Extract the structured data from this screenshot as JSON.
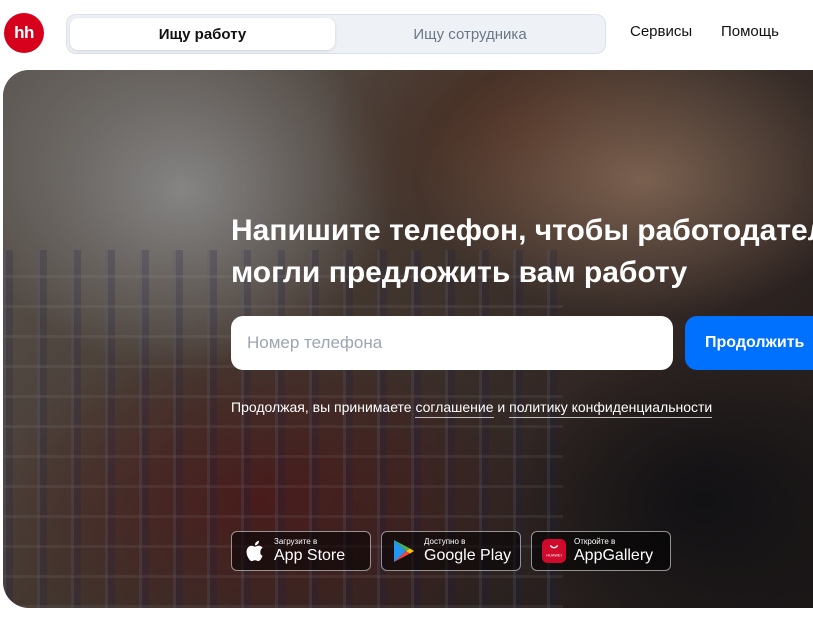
{
  "header": {
    "logo_text": "hh",
    "role_tabs": [
      {
        "label": "Ищу работу",
        "active": true
      },
      {
        "label": "Ищу сотрудника",
        "active": false
      }
    ],
    "nav_links": [
      {
        "label": "Сервисы"
      },
      {
        "label": "Помощь"
      }
    ]
  },
  "hero": {
    "title_line1": "Напишите телефон, чтобы работодатели",
    "title_line2": "могли предложить вам работу",
    "phone_placeholder": "Номер телефона",
    "phone_value": "",
    "continue_label": "Продолжить",
    "consent_prefix": "Продолжая, вы принимаете ",
    "consent_link_agreement": "соглашение",
    "consent_and": " и ",
    "consent_link_privacy": "политику конфиденциальности"
  },
  "stores": [
    {
      "small": "Загрузите в",
      "big": "App Store",
      "icon": "apple-icon"
    },
    {
      "small": "Доступно в",
      "big": "Google Play",
      "icon": "google-play-icon"
    },
    {
      "small": "Откройте в",
      "big": "AppGallery",
      "icon": "huawei-appgallery-icon",
      "icon_text": "HUAWEI"
    }
  ],
  "colors": {
    "brand_red": "#d6001c",
    "primary_blue": "#0070ff",
    "switch_bg": "#eef2f7"
  }
}
